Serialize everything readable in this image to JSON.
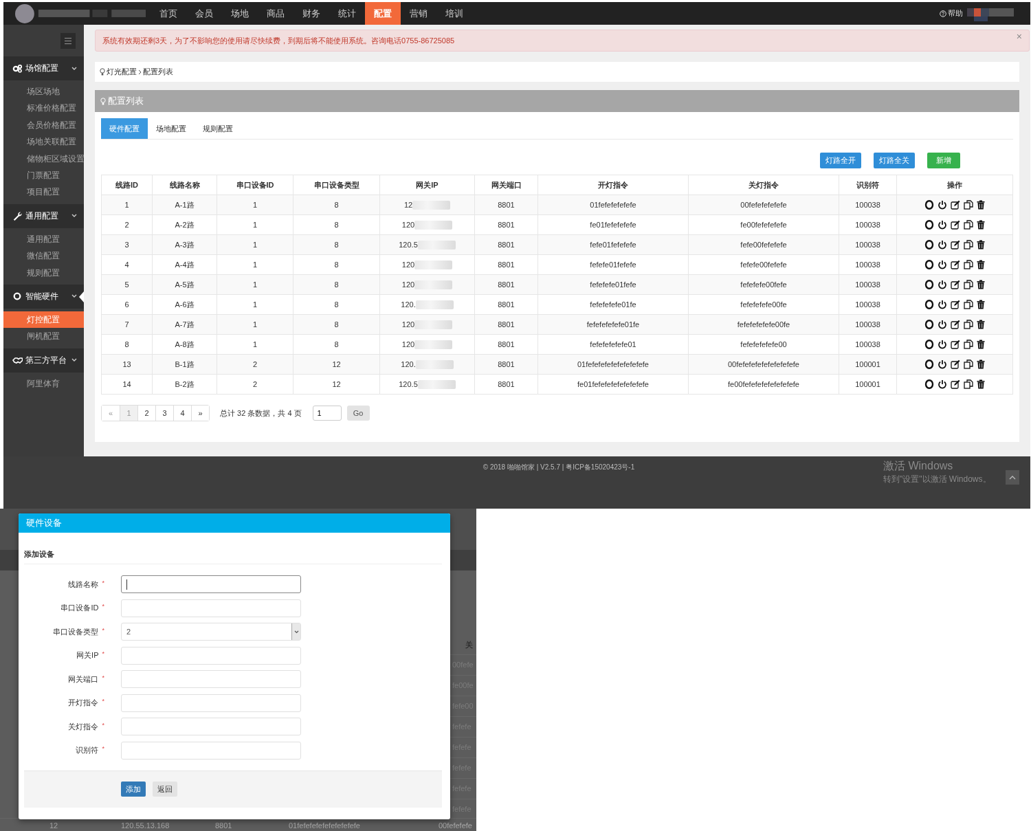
{
  "top_nav": {
    "items": [
      {
        "label": "首页",
        "selected": false
      },
      {
        "label": "会员",
        "selected": false
      },
      {
        "label": "场地",
        "selected": false
      },
      {
        "label": "商品",
        "selected": false
      },
      {
        "label": "财务",
        "selected": false
      },
      {
        "label": "统计",
        "selected": false
      },
      {
        "label": "配置",
        "selected": true
      },
      {
        "label": "营销",
        "selected": false
      },
      {
        "label": "培训",
        "selected": false
      }
    ],
    "help": "帮助"
  },
  "sidebar": {
    "groups": [
      {
        "label": "场馆配置",
        "selected": false,
        "items": [
          {
            "label": "场区场地",
            "selected": false
          },
          {
            "label": "标准价格配置",
            "selected": false
          },
          {
            "label": "会员价格配置",
            "selected": false
          },
          {
            "label": "场地关联配置",
            "selected": false
          },
          {
            "label": "储物柜区域设置",
            "selected": false
          },
          {
            "label": "门票配置",
            "selected": false
          },
          {
            "label": "项目配置",
            "selected": false
          }
        ]
      },
      {
        "label": "通用配置",
        "selected": false,
        "items": [
          {
            "label": "通用配置",
            "selected": false
          },
          {
            "label": "微信配置",
            "selected": false
          },
          {
            "label": "规则配置",
            "selected": false
          }
        ]
      },
      {
        "label": "智能硬件",
        "selected": true,
        "items": [
          {
            "label": "灯控配置",
            "selected": true
          },
          {
            "label": "闸机配置",
            "selected": false
          }
        ]
      },
      {
        "label": "第三方平台",
        "selected": false,
        "items": [
          {
            "label": "阿里体育",
            "selected": false
          }
        ]
      }
    ]
  },
  "alert": {
    "text": "系统有效期还剩3天，为了不影响您的使用请尽快续费，到期后将不能使用系统。咨询电话0755-86725085",
    "close": "×"
  },
  "breadcrumb": [
    "灯光配置",
    "配置列表"
  ],
  "panel": {
    "title": "配置列表",
    "tabs": [
      {
        "label": "硬件配置",
        "selected": true
      },
      {
        "label": "场地配置",
        "selected": false
      },
      {
        "label": "规则配置",
        "selected": false
      }
    ],
    "actions": [
      {
        "label": "灯路全开",
        "kind": "primary"
      },
      {
        "label": "灯路全关",
        "kind": "primary"
      },
      {
        "label": "新增",
        "kind": "success"
      }
    ],
    "table": {
      "columns": [
        "线路ID",
        "线路名称",
        "串口设备ID",
        "串口设备类型",
        "网关IP",
        "网关端口",
        "开灯指令",
        "关灯指令",
        "识别符",
        "操作"
      ],
      "rows": [
        [
          "1",
          "A-1路",
          "1",
          "8",
          "12",
          "8801",
          "01fefefefefefe",
          "00fefefefefefe",
          "100038"
        ],
        [
          "2",
          "A-2路",
          "1",
          "8",
          "120",
          "8801",
          "fe01fefefefefe",
          "fe00fefefefefe",
          "100038"
        ],
        [
          "3",
          "A-3路",
          "1",
          "8",
          "120.5",
          "8801",
          "fefe01fefefefe",
          "fefe00fefefefe",
          "100038"
        ],
        [
          "4",
          "A-4路",
          "1",
          "8",
          "120",
          "8801",
          "fefefe01fefefe",
          "fefefe00fefefe",
          "100038"
        ],
        [
          "5",
          "A-5路",
          "1",
          "8",
          "120",
          "8801",
          "fefefefe01fefe",
          "fefefefe00fefe",
          "100038"
        ],
        [
          "6",
          "A-6路",
          "1",
          "8",
          "120.",
          "8801",
          "fefefefefe01fe",
          "fefefefefe00fe",
          "100038"
        ],
        [
          "7",
          "A-7路",
          "1",
          "8",
          "120",
          "8801",
          "fefefefefefe01fe",
          "fefefefefefe00fe",
          "100038"
        ],
        [
          "8",
          "A-8路",
          "1",
          "8",
          "120",
          "8801",
          "fefefefefefe01",
          "fefefefefefe00",
          "100038"
        ],
        [
          "13",
          "B-1路",
          "2",
          "12",
          "120.",
          "8801",
          "01fefefefefefefefefefe",
          "00fefefefefefefefefefe",
          "100001"
        ],
        [
          "14",
          "B-2路",
          "2",
          "12",
          "120.5",
          "8801",
          "fe01fefefefefefefefefe",
          "fe00fefefefefefefefefe",
          "100001"
        ]
      ]
    },
    "pagination": {
      "prev": "«",
      "pages": [
        {
          "label": "1",
          "selected": true
        },
        {
          "label": "2",
          "selected": false
        },
        {
          "label": "3",
          "selected": false
        },
        {
          "label": "4",
          "selected": false
        }
      ],
      "next": "»",
      "summary": "总计 32 条数据，共 4 页",
      "page_input": "1",
      "go": "Go"
    }
  },
  "footer": {
    "text": "© 2018 啪啪馆家 | V2.5.7 | 粤ICP备15020423号-1",
    "activation_title": "激活 Windows",
    "activation_hint": "转到\"设置\"以激活 Windows。"
  },
  "modal": {
    "title": "硬件设备",
    "section": "添加设备",
    "fields": [
      {
        "label": "线路名称",
        "required_mark": "*",
        "kind": "text",
        "focused": true
      },
      {
        "label": "串口设备ID",
        "required_mark": "*",
        "kind": "text",
        "focused": false
      },
      {
        "label": "串口设备类型",
        "required_mark": "*",
        "kind": "select",
        "value": "2",
        "focused": false
      },
      {
        "label": "网关IP",
        "required_mark": "*",
        "kind": "text",
        "focused": false
      },
      {
        "label": "网关端口",
        "required_mark": "*",
        "kind": "text",
        "focused": false
      },
      {
        "label": "开灯指令",
        "required_mark": "*",
        "kind": "text",
        "focused": false
      },
      {
        "label": "关灯指令",
        "required_mark": "*",
        "kind": "text",
        "focused": false
      },
      {
        "label": "识别符",
        "required_mark": "*",
        "kind": "text",
        "focused": false
      }
    ],
    "buttons": [
      {
        "label": "添加",
        "kind": "primary"
      },
      {
        "label": "返回",
        "kind": "default"
      }
    ]
  },
  "backdrop": {
    "header": "关",
    "cells": [
      "00fefe",
      "fe00fe",
      "fefe00",
      "fefefe",
      "fefefe",
      "fefefe",
      "fefefe",
      "fefefe"
    ],
    "bottom_row": [
      "12",
      "120.55.13.168",
      "8801",
      "01fefefefefefefefefefe",
      "00fefefefe"
    ]
  }
}
